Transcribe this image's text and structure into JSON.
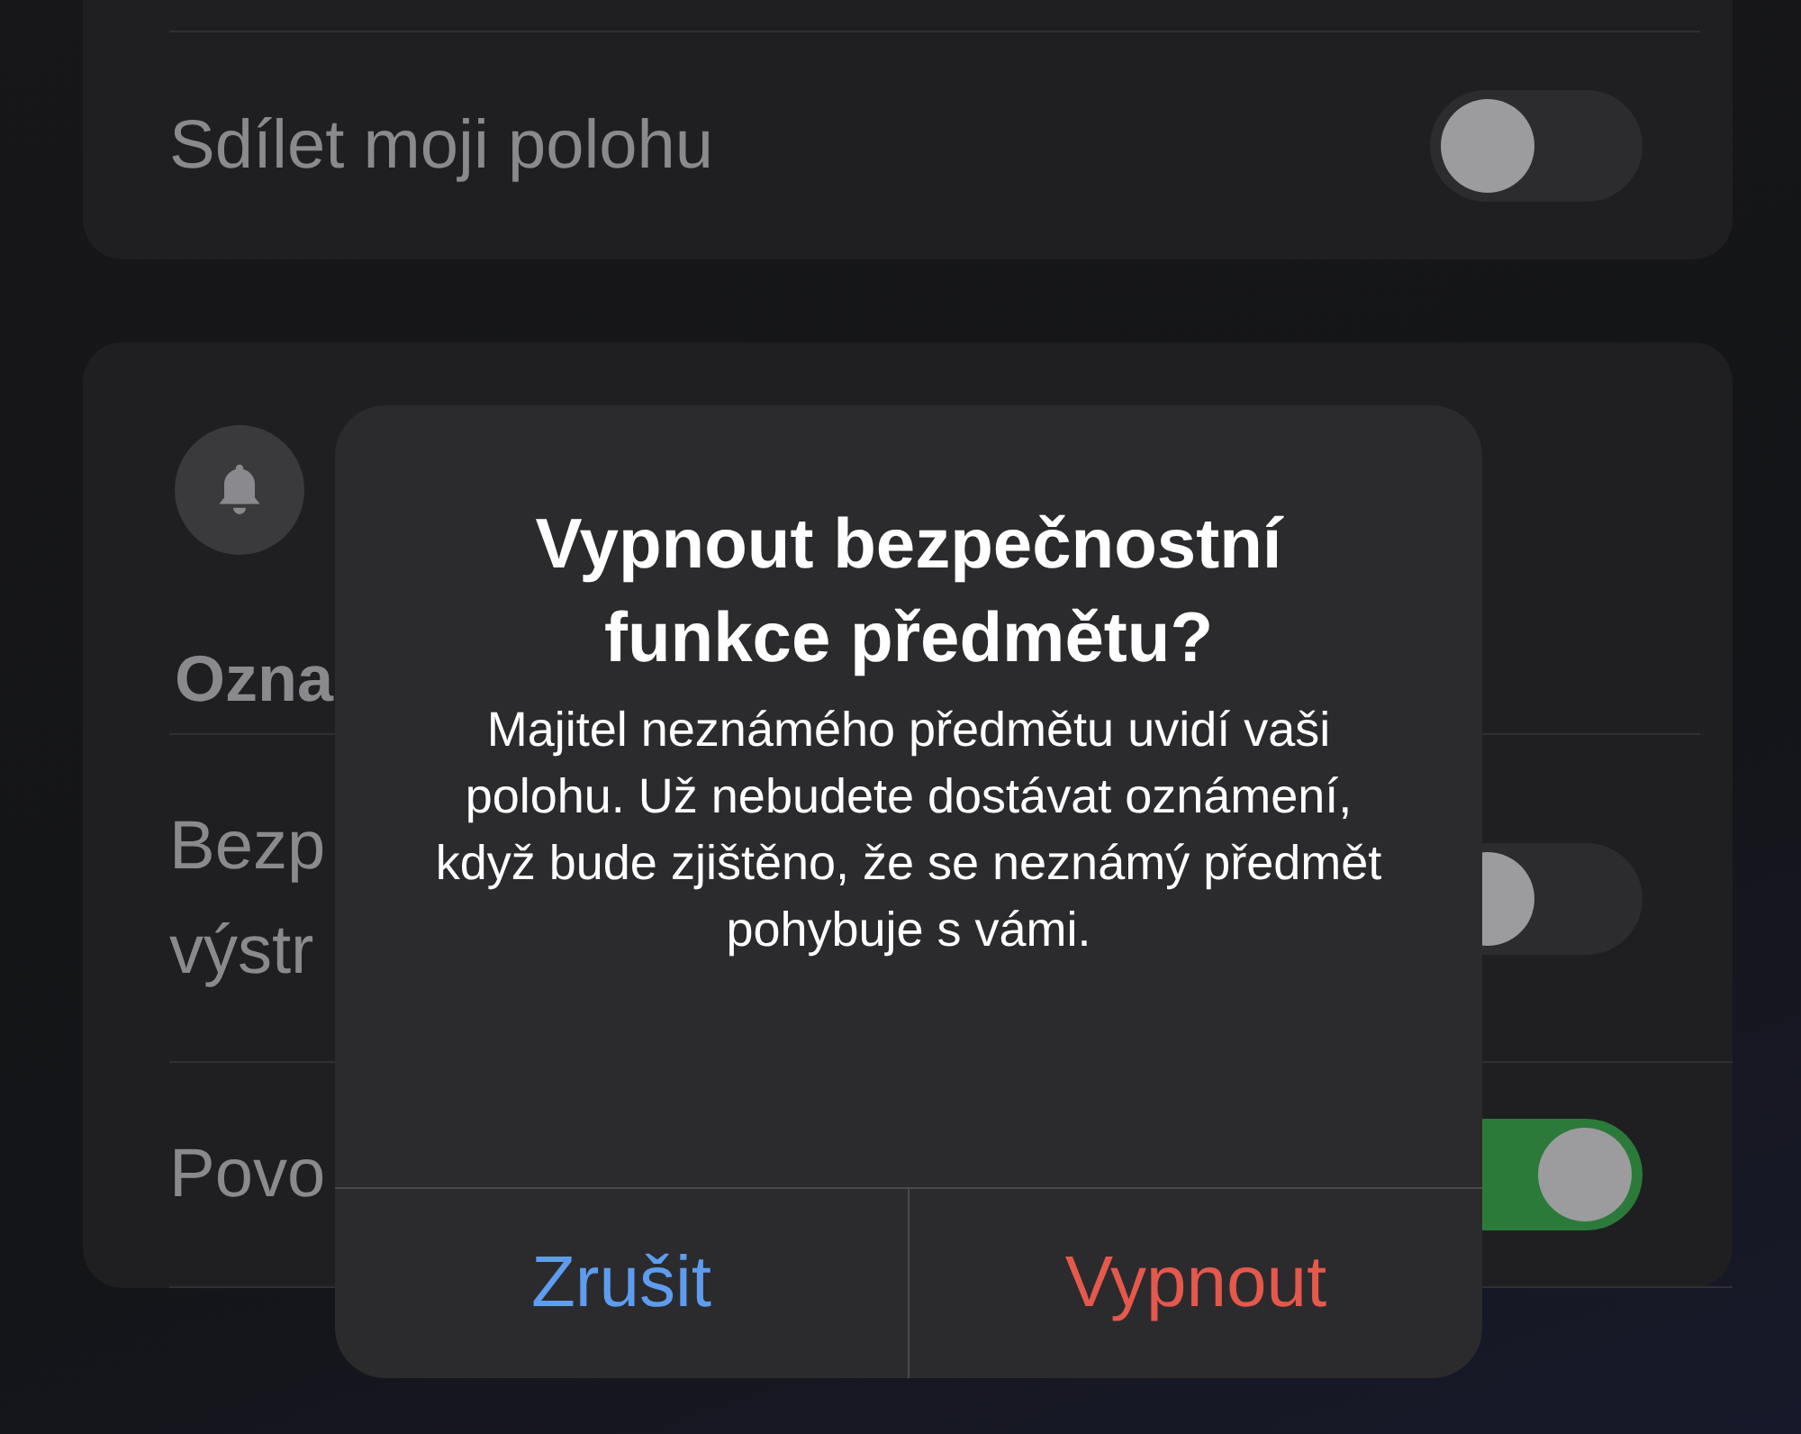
{
  "settings": {
    "cards": [
      {
        "rows": [
          {
            "kind": "toggle",
            "lines": [
              "Sdílet moji polohu"
            ],
            "on": false
          }
        ]
      },
      {
        "header": {
          "title": "Ozna"
        },
        "rows": [
          {
            "kind": "toggle",
            "lines": [
              "Bezp",
              "výstr"
            ],
            "on": false
          },
          {
            "kind": "toggle",
            "lines": [
              "Povo"
            ],
            "on": true
          }
        ]
      }
    ]
  },
  "alert": {
    "title": "Vypnout bezpečnostní funkce předmětu?",
    "message": "Majitel neznámého předmětu uvidí vaši polohu. Už nebudete dostávat oznámení, když bude zjištěno, že se neznámý předmět pohybuje s vámi.",
    "buttons": [
      {
        "label": "Zrušit",
        "kind": "cancel"
      },
      {
        "label": "Vypnout",
        "kind": "destructive"
      }
    ]
  }
}
